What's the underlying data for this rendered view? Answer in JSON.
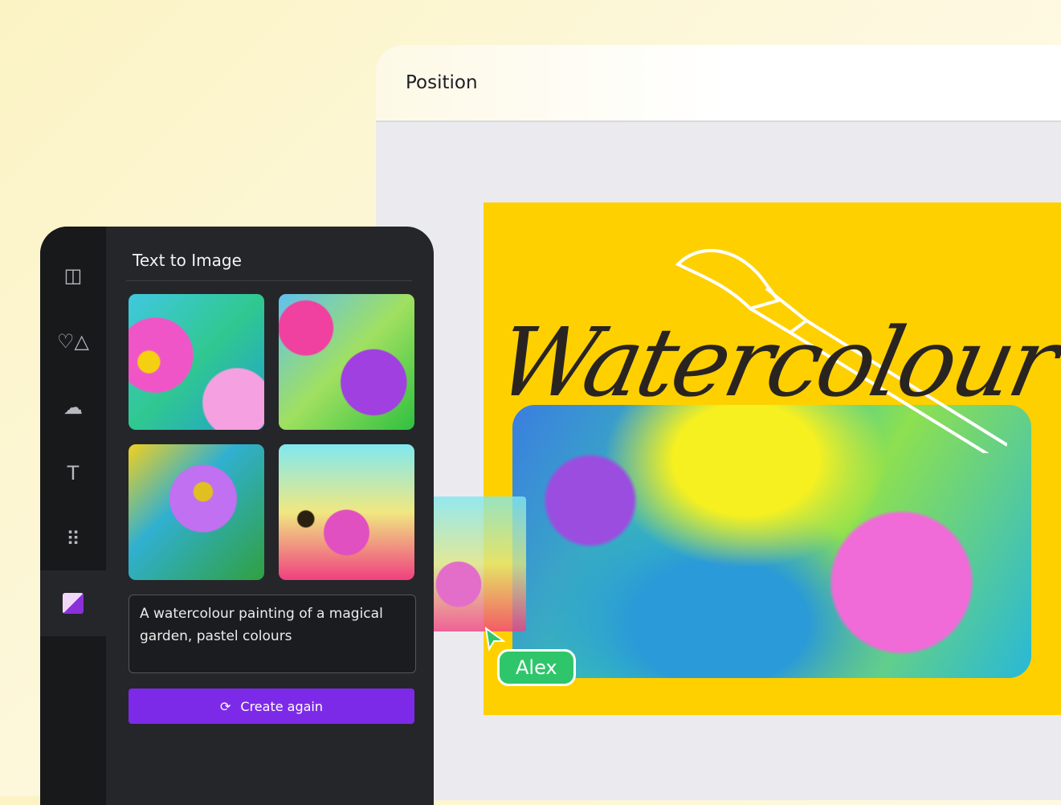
{
  "editor": {
    "toolbar_title": "Position"
  },
  "canvas": {
    "title": "Watercolour",
    "collaborator": "Alex",
    "background_color": "#ffd000"
  },
  "sidebar": {
    "items": [
      {
        "icon": "layout-icon"
      },
      {
        "icon": "elements-icon"
      },
      {
        "icon": "upload-icon"
      },
      {
        "icon": "text-icon"
      },
      {
        "icon": "apps-icon"
      },
      {
        "icon": "text-to-image-app-icon",
        "active": true
      }
    ]
  },
  "panel": {
    "title": "Text to Image",
    "prompt": "A watercolour painting of a magical garden, pastel colours",
    "create_button": "Create again",
    "accent": "#7d2ae8"
  }
}
